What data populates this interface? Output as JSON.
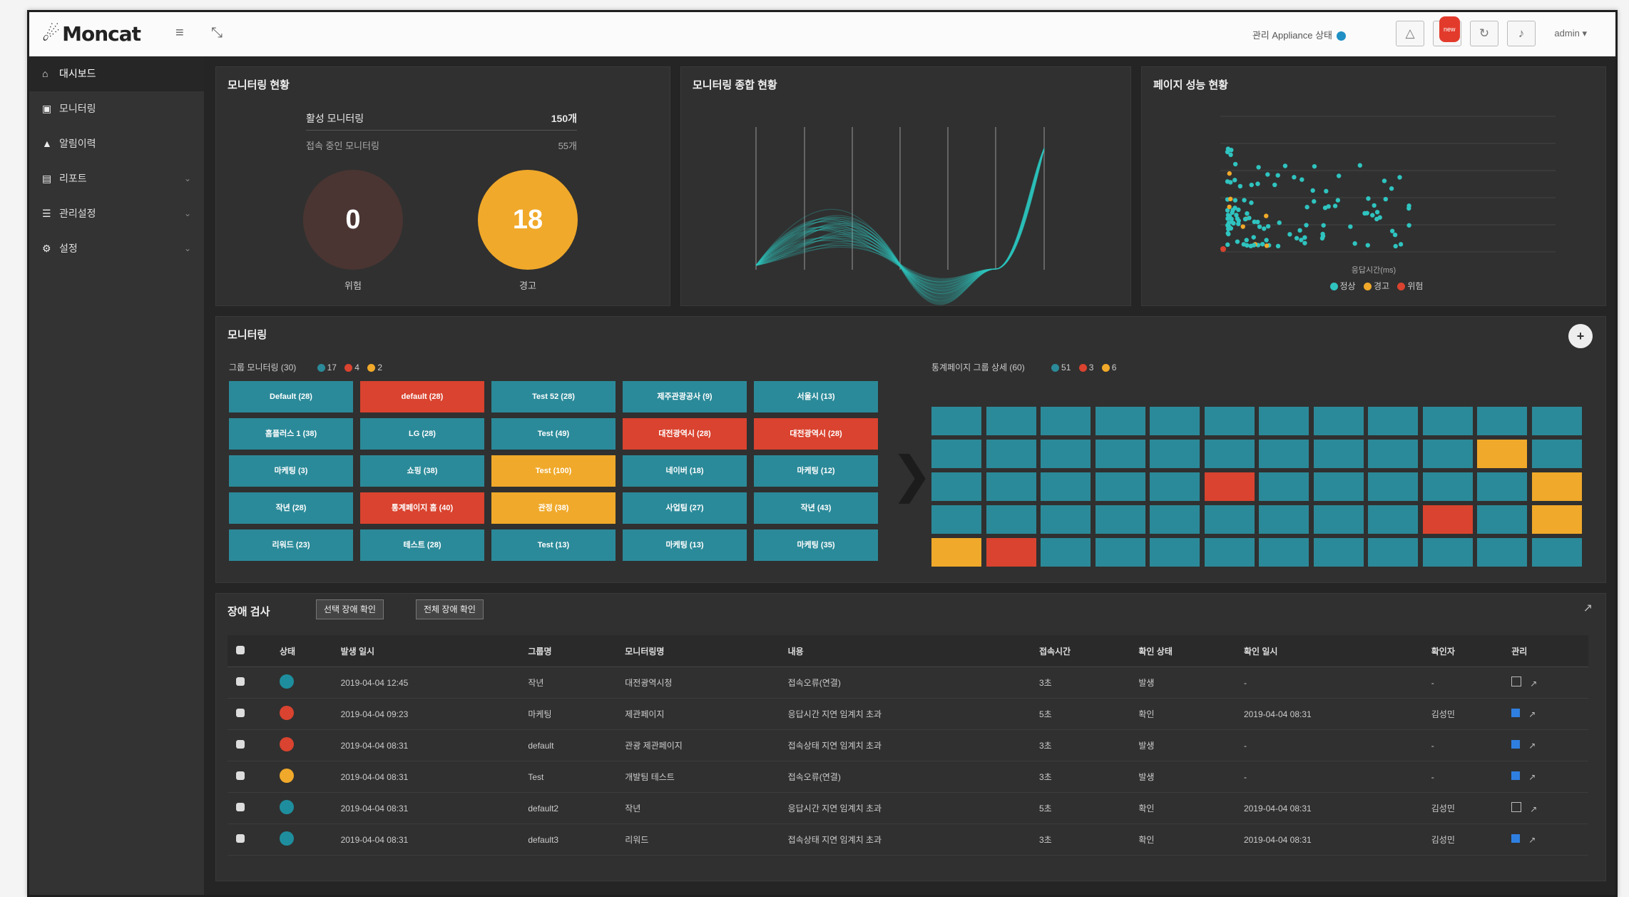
{
  "app": {
    "logo": "Moncat",
    "status_text": "관리 Appliance 상태",
    "user": "admin",
    "notification_count": "new"
  },
  "colors": {
    "normal": "#2b8a99",
    "warning": "#f0a92a",
    "danger": "#d9432f",
    "ok_dot": "#1f8fc4"
  },
  "sidebar": {
    "items": [
      {
        "label": "대시보드",
        "icon": "home-icon",
        "active": true
      },
      {
        "label": "모니터링",
        "icon": "monitor-icon"
      },
      {
        "label": "알림이력",
        "icon": "bell-icon"
      },
      {
        "label": "리포트",
        "icon": "file-icon",
        "expandable": true
      },
      {
        "label": "관리설정",
        "icon": "list-icon",
        "expandable": true
      },
      {
        "label": "설정",
        "icon": "gear-icon",
        "expandable": true
      }
    ]
  },
  "summary": {
    "title": "모니터링 현황",
    "active_label": "활성 모니터링",
    "active_value": "150개",
    "sub_label": "접속 중인 모니터링",
    "sub_value": "55개",
    "danger_value": "0",
    "danger_label": "위험",
    "warn_value": "18",
    "warn_label": "경고"
  },
  "parallel": {
    "title": "모니터링 종합 현황"
  },
  "scatter": {
    "title": "페이지 성능 현황",
    "xlabel": "응답시간(ms)",
    "legend": [
      "정상",
      "경고",
      "위험"
    ]
  },
  "groups": {
    "title": "모니터링",
    "left_title": "그룹 모니터링 (30)",
    "left_legend": [
      "17",
      "4",
      "2"
    ],
    "right_title": "통계페이지 그룹 상세 (60)",
    "right_legend": [
      "51",
      "3",
      "6"
    ],
    "cells": [
      {
        "label": "Default (28)",
        "s": "n"
      },
      {
        "label": "default (28)",
        "s": "d"
      },
      {
        "label": "Test 52 (28)",
        "s": "n"
      },
      {
        "label": "제주관광공사 (9)",
        "s": "n"
      },
      {
        "label": "서울시 (13)",
        "s": "n"
      },
      {
        "label": "홈플러스 1 (38)",
        "s": "n"
      },
      {
        "label": "LG (28)",
        "s": "n"
      },
      {
        "label": "Test (49)",
        "s": "n"
      },
      {
        "label": "대전광역시 (28)",
        "s": "d"
      },
      {
        "label": "대전광역시 (28)",
        "s": "d"
      },
      {
        "label": "마케팅 (3)",
        "s": "n"
      },
      {
        "label": "쇼핑 (38)",
        "s": "n"
      },
      {
        "label": "Test (100)",
        "s": "w"
      },
      {
        "label": "네이버 (18)",
        "s": "n"
      },
      {
        "label": "마케팅 (12)",
        "s": "n"
      },
      {
        "label": "작년 (28)",
        "s": "n"
      },
      {
        "label": "통계페이지 홈 (40)",
        "s": "d"
      },
      {
        "label": "관정 (38)",
        "s": "w"
      },
      {
        "label": "사업팀 (27)",
        "s": "n"
      },
      {
        "label": "작년 (43)",
        "s": "n"
      },
      {
        "label": "리워드 (23)",
        "s": "n"
      },
      {
        "label": "테스트 (28)",
        "s": "n"
      },
      {
        "label": "Test (13)",
        "s": "n"
      },
      {
        "label": "마케팅 (13)",
        "s": "n"
      },
      {
        "label": "마케팅 (35)",
        "s": "n"
      }
    ],
    "heat": [
      "nnnnnnnnnnnn",
      "nnnnnnnnnnwn",
      "nnnnndnnnnnw",
      "nnnnnnnnndnw",
      "wdnnnnnnnnnn"
    ]
  },
  "events": {
    "title": "장애 검사",
    "btn_confirm": "선택 장애 확인",
    "btn_all": "전체 장애 확인",
    "columns": [
      "",
      "상태",
      "발생 일시",
      "그룹명",
      "모니터링명",
      "내용",
      "접속시간",
      "확인 상태",
      "확인 일시",
      "확인자",
      "관리"
    ],
    "rows": [
      {
        "status": "n",
        "date": "2019-04-04 12:45",
        "group": "작년",
        "name": "대전광역시청",
        "content": "접속오류(연결)",
        "time": "3초",
        "state": "발생",
        "cdate": "-",
        "by": "-",
        "mgmt": "doc"
      },
      {
        "status": "d",
        "date": "2019-04-04 09:23",
        "group": "마케팅",
        "name": "제관페이지",
        "content": "응답시간 지연 임계치 초과",
        "time": "5초",
        "state": "확인",
        "cdate": "2019-04-04 08:31",
        "by": "김성민",
        "mgmt": "check"
      },
      {
        "status": "d",
        "date": "2019-04-04 08:31",
        "group": "default",
        "name": "관광 제관페이지",
        "content": "접속상태 지연 임계치 초과",
        "time": "3초",
        "state": "발생",
        "cdate": "-",
        "by": "-",
        "mgmt": "check"
      },
      {
        "status": "w",
        "date": "2019-04-04 08:31",
        "group": "Test",
        "name": "개발팀 테스트",
        "content": "접속오류(연결)",
        "time": "3초",
        "state": "발생",
        "cdate": "-",
        "by": "-",
        "mgmt": "check"
      },
      {
        "status": "n",
        "date": "2019-04-04 08:31",
        "group": "default2",
        "name": "작년",
        "content": "응답시간 지연 임계치 초과",
        "time": "5초",
        "state": "확인",
        "cdate": "2019-04-04 08:31",
        "by": "김성민",
        "mgmt": "doc"
      },
      {
        "status": "n",
        "date": "2019-04-04 08:31",
        "group": "default3",
        "name": "리워드",
        "content": "접속상태 지연 임계치 초과",
        "time": "3초",
        "state": "확인",
        "cdate": "2019-04-04 08:31",
        "by": "김성민",
        "mgmt": "check"
      }
    ]
  }
}
